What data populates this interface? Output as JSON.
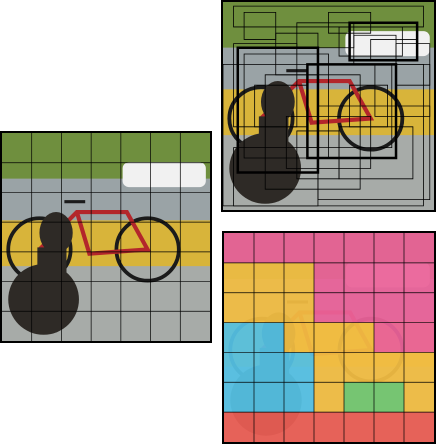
{
  "grid": {
    "rows": 7,
    "cols": 7
  },
  "class_colors": {
    "pink": "#e84c8b",
    "yellow": "#f0b429",
    "cyan": "#3db8e0",
    "green": "#5fbf5a",
    "red": "#e8473c"
  },
  "class_map": [
    [
      "pink",
      "pink",
      "pink",
      "pink",
      "pink",
      "pink",
      "pink"
    ],
    [
      "yellow",
      "yellow",
      "yellow",
      "pink",
      "pink",
      "pink",
      "pink"
    ],
    [
      "yellow",
      "yellow",
      "yellow",
      "pink",
      "pink",
      "pink",
      "pink"
    ],
    [
      "cyan",
      "cyan",
      "yellow",
      "yellow",
      "yellow",
      "pink",
      "pink"
    ],
    [
      "cyan",
      "cyan",
      "cyan",
      "yellow",
      "yellow",
      "yellow",
      "yellow"
    ],
    [
      "cyan",
      "cyan",
      "cyan",
      "yellow",
      "green",
      "green",
      "yellow"
    ],
    [
      "red",
      "red",
      "red",
      "red",
      "red",
      "red",
      "red"
    ]
  ],
  "scene_palette": {
    "tree": "#6f8f3e",
    "sky": "#c9d3d2",
    "road": "#9aa3a6",
    "fence": "#d8b43a",
    "porch": "#a7aba8",
    "dog": "#2e2a26",
    "bike_red": "#b3262b",
    "car": "#f1f1f1"
  },
  "detection_boxes": [
    [
      0.05,
      0.02,
      0.95,
      0.12
    ],
    [
      0.35,
      0.1,
      0.62,
      0.22
    ],
    [
      0.55,
      0.12,
      0.85,
      0.26
    ],
    [
      0.62,
      0.16,
      0.82,
      0.3
    ],
    [
      0.7,
      0.18,
      0.92,
      0.28
    ],
    [
      0.05,
      0.2,
      0.35,
      0.6
    ],
    [
      0.1,
      0.25,
      0.5,
      0.75
    ],
    [
      0.2,
      0.35,
      0.65,
      0.9
    ],
    [
      0.4,
      0.3,
      0.8,
      0.7
    ],
    [
      0.0,
      0.3,
      0.95,
      0.98
    ],
    [
      0.45,
      0.5,
      0.98,
      0.95
    ],
    [
      0.3,
      0.55,
      0.7,
      0.8
    ],
    [
      0.6,
      0.4,
      0.78,
      0.6
    ],
    [
      0.15,
      0.4,
      0.4,
      0.6
    ],
    [
      0.5,
      0.05,
      0.7,
      0.15
    ],
    [
      0.72,
      0.3,
      0.98,
      0.55
    ],
    [
      0.05,
      0.7,
      0.45,
      0.98
    ],
    [
      0.25,
      0.15,
      0.45,
      0.35
    ],
    [
      0.82,
      0.2,
      0.98,
      0.4
    ],
    [
      0.35,
      0.62,
      0.55,
      0.85
    ],
    [
      0.1,
      0.05,
      0.25,
      0.18
    ],
    [
      0.55,
      0.6,
      0.9,
      0.85
    ]
  ],
  "detection_boxes_bold": [
    [
      0.07,
      0.22,
      0.45,
      0.82
    ],
    [
      0.4,
      0.3,
      0.82,
      0.75
    ],
    [
      0.6,
      0.1,
      0.92,
      0.28
    ]
  ]
}
